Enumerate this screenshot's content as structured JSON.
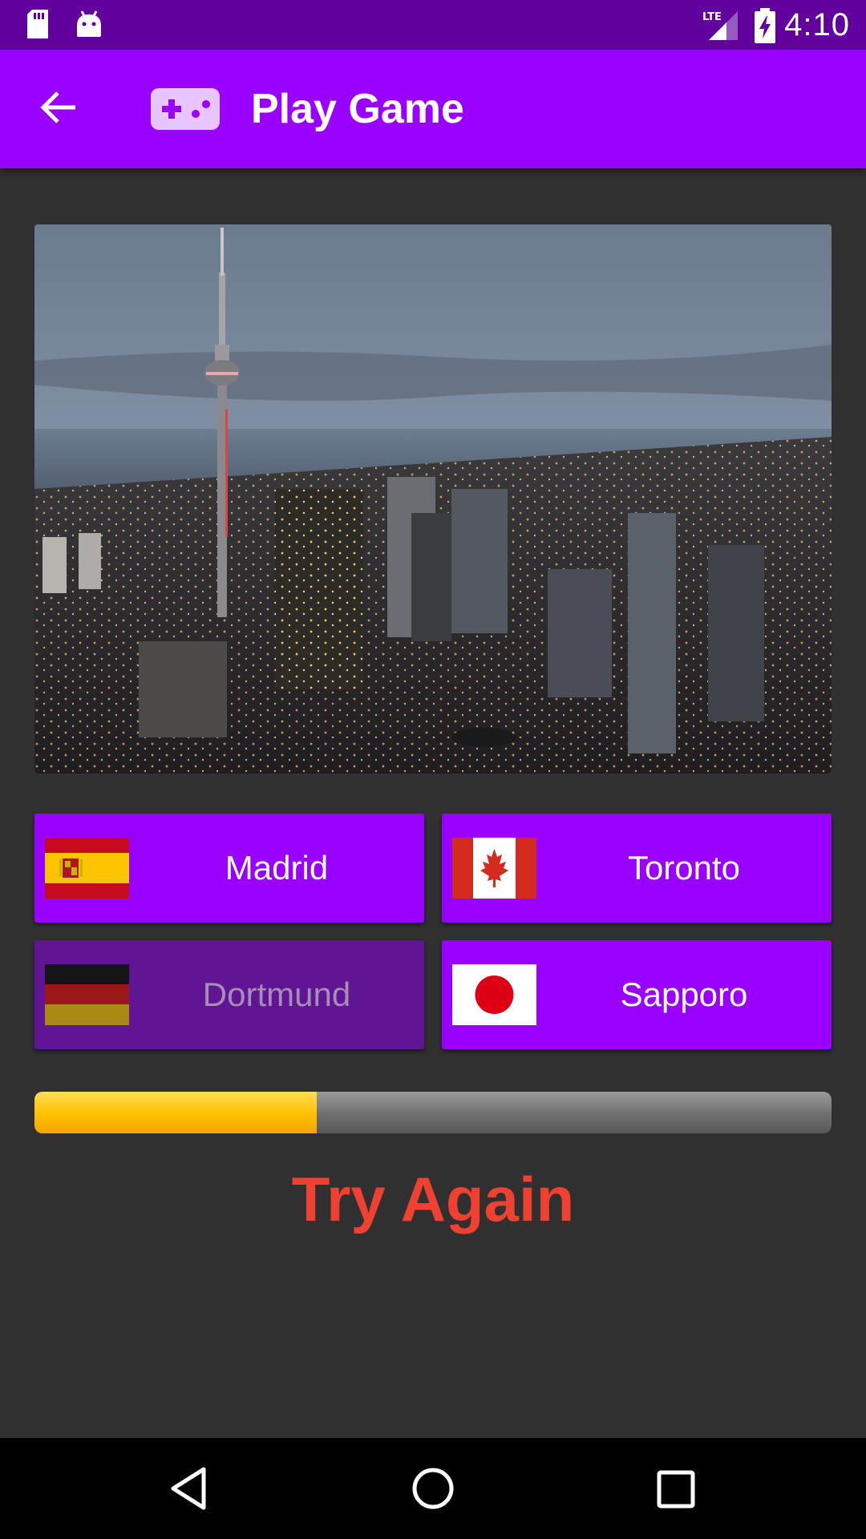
{
  "status_bar": {
    "time": "4:10",
    "network": "LTE",
    "icons": [
      "sd-card-icon",
      "android-icon",
      "signal-lte-icon",
      "battery-charging-icon"
    ]
  },
  "app_bar": {
    "title": "Play Game",
    "back_icon": "arrow-back-icon",
    "title_icon": "gamepad-icon"
  },
  "question": {
    "image": "toronto-skyline-photo"
  },
  "answers": [
    {
      "label": "Madrid",
      "flag": "spain-flag-icon",
      "enabled": true
    },
    {
      "label": "Toronto",
      "flag": "canada-flag-icon",
      "enabled": true
    },
    {
      "label": "Dortmund",
      "flag": "germany-flag-icon",
      "enabled": false
    },
    {
      "label": "Sapporo",
      "flag": "japan-flag-icon",
      "enabled": true
    }
  ],
  "progress": {
    "fraction": 0.354
  },
  "result": {
    "text": "Try Again"
  },
  "colors": {
    "status_bar": "#62009e",
    "app_bar": "#9900ff",
    "button": "#9900ff",
    "button_disabled": "#5f1594",
    "background": "#303030",
    "result_text": "#ee4131",
    "progress_fill": "#ffc000"
  },
  "nav_bar": {
    "icons": [
      "nav-back-icon",
      "nav-home-icon",
      "nav-recents-icon"
    ]
  }
}
